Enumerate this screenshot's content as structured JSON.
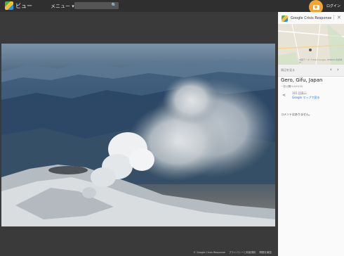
{
  "header": {
    "app_title": "ビュー",
    "menu_label": "メニュー",
    "search_placeholder": "",
    "login_label": "ログイン"
  },
  "photo_footer": {
    "copyright": "© Google Crisis Response",
    "privacy": "プライバシーと利用規約",
    "report": "問題を報告"
  },
  "panel": {
    "publisher": "Google Crisis Response",
    "map_caption": "地図データ ©2014 Google, ZENRIN  利用規約",
    "nearby_label": "周辺を見る",
    "place_name": "Gero, Gifu, Japan",
    "published_label": "一般公開",
    "published_date": "2014/09/30",
    "views": "301 回表示",
    "map_link": "Google マップで見る",
    "comments": "コメントはありません。"
  }
}
